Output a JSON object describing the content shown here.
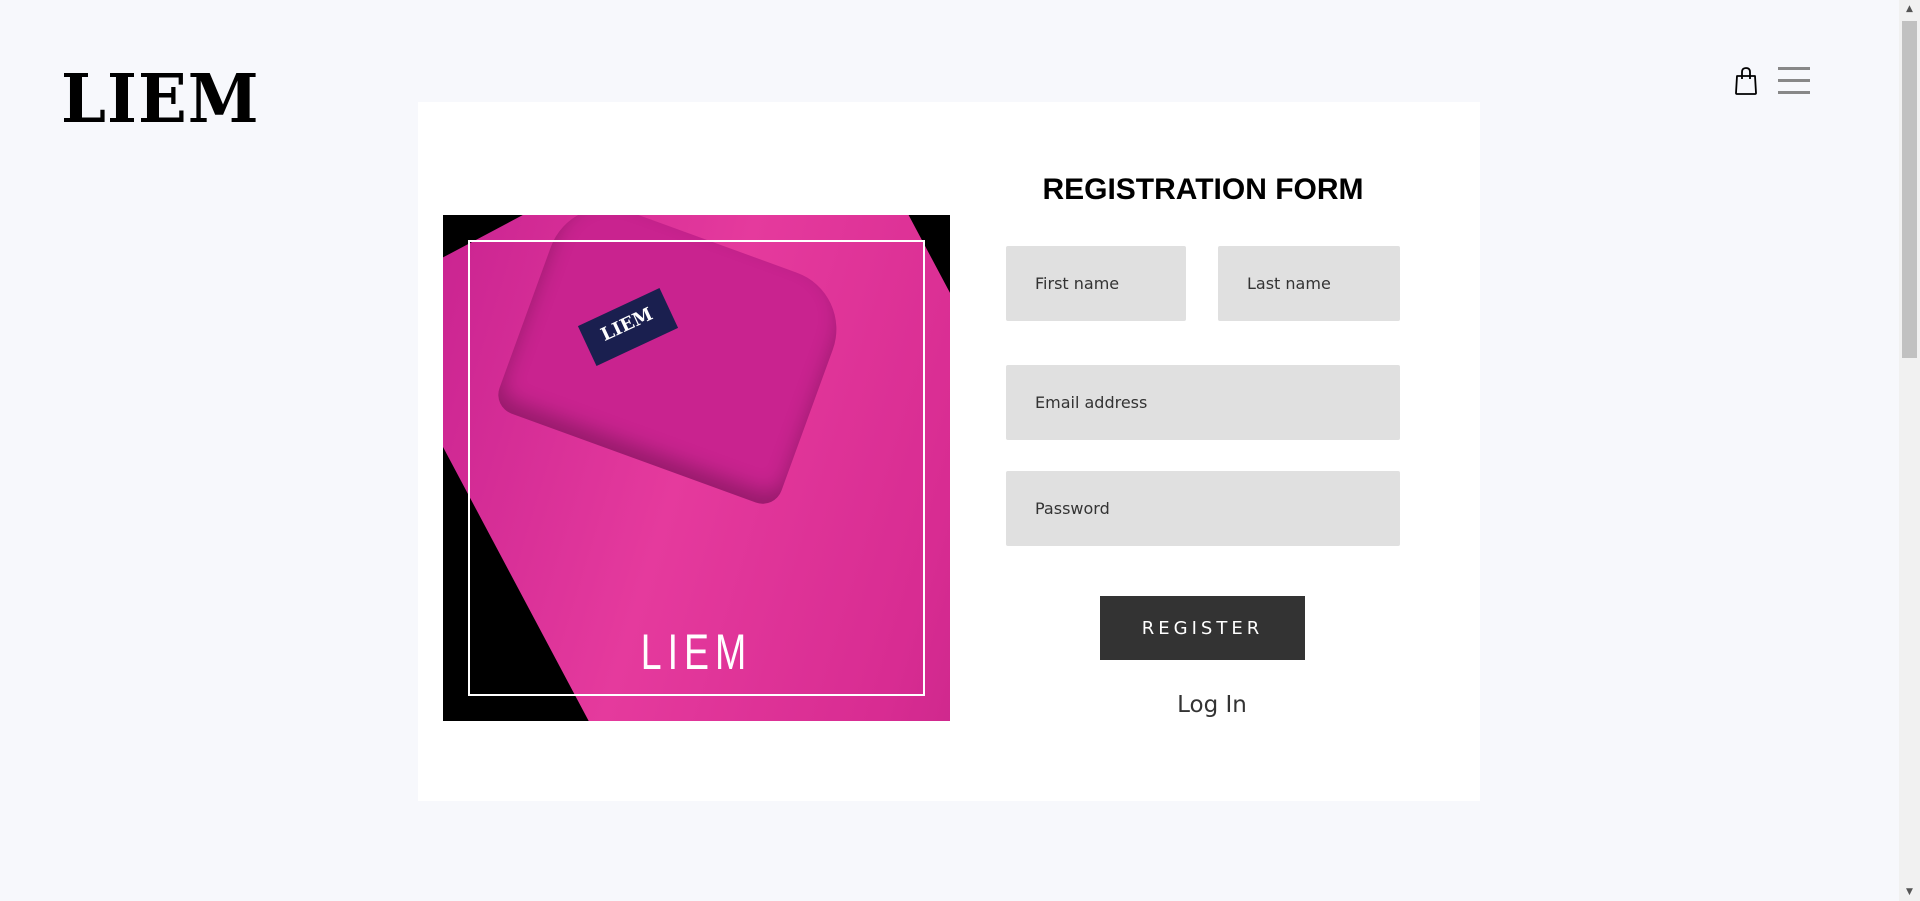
{
  "header": {
    "logo": "LIEM",
    "cart_icon": "shopping-bag-icon",
    "menu_icon": "hamburger-menu-icon"
  },
  "hero_image": {
    "brand_text": "LIEM",
    "tag_text": "LIEM"
  },
  "form": {
    "title": "REGISTRATION FORM",
    "first_name_placeholder": "First name",
    "last_name_placeholder": "Last name",
    "email_placeholder": "Email address",
    "password_placeholder": "Password",
    "register_label": "REGISTER",
    "login_label": "Log In"
  }
}
